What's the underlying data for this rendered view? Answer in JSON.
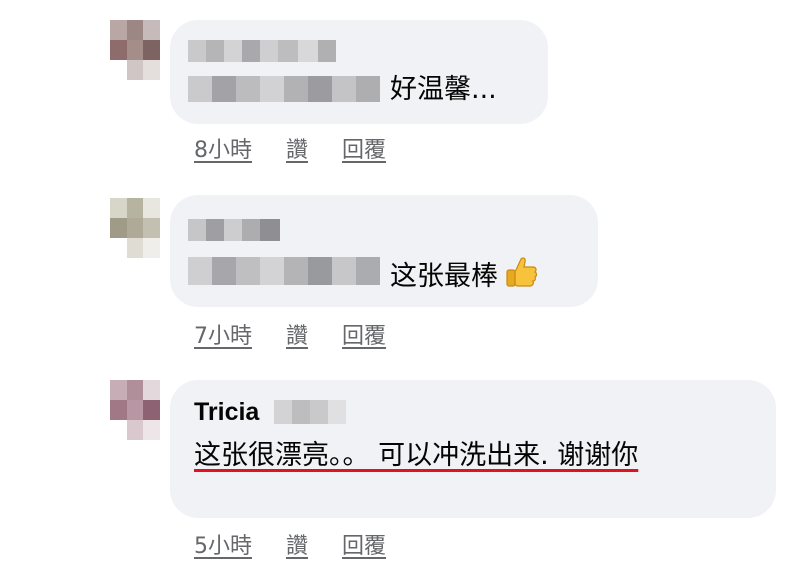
{
  "comments": [
    {
      "author_blurred": true,
      "text": "好温馨...",
      "time": "8小時",
      "like_label": "讚",
      "reply_label": "回覆"
    },
    {
      "author_blurred": true,
      "text": "这张最棒",
      "emoji_icon": "thumbs-up-icon",
      "time": "7小時",
      "like_label": "讚",
      "reply_label": "回覆"
    },
    {
      "author": "Tricia",
      "text": "这张很漂亮。。 可以冲洗出来. 谢谢你",
      "time": "5小時",
      "like_label": "讚",
      "reply_label": "回覆",
      "underline_color": "#e0141e"
    }
  ],
  "colors": {
    "bubble_bg": "#f0f2f5",
    "meta_text": "#65676b",
    "annotation_red": "#e0141e"
  }
}
